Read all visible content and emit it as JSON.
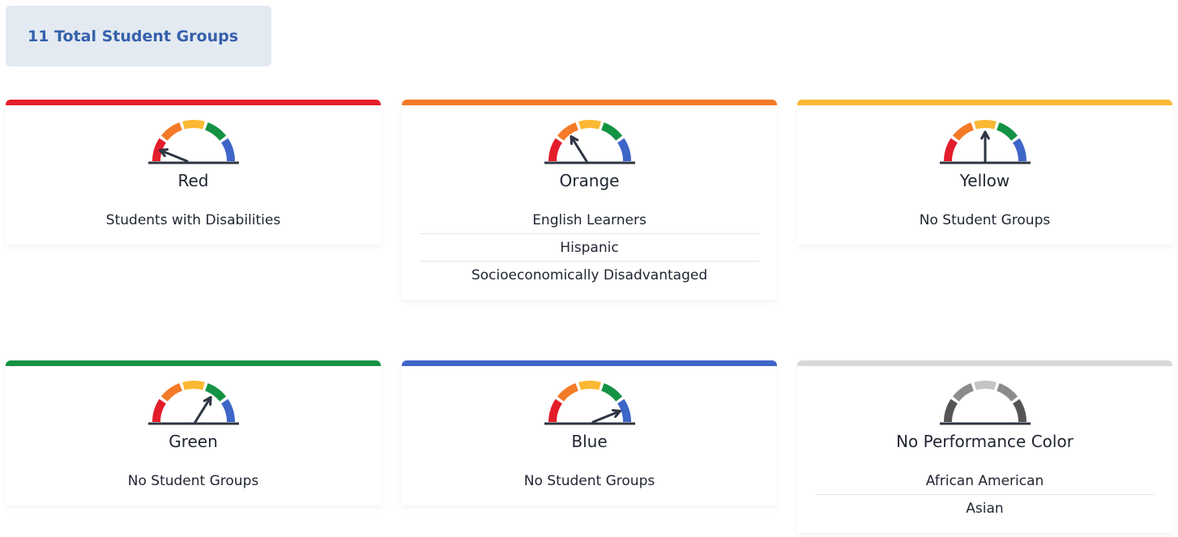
{
  "summary": {
    "total_label": "11 Total Student Groups"
  },
  "colors": {
    "red": "#e41d2b",
    "orange": "#f47a28",
    "yellow": "#fbb832",
    "green": "#139343",
    "blue": "#3e65c8",
    "none": "#d8d8d8",
    "needle": "#2d3442"
  },
  "cards": [
    {
      "label": "Red",
      "level": "red",
      "groups": [
        "Students with Disabilities"
      ]
    },
    {
      "label": "Orange",
      "level": "orange",
      "groups": [
        "English Learners",
        "Hispanic",
        "Socioeconomically Disadvantaged"
      ]
    },
    {
      "label": "Yellow",
      "level": "yellow",
      "groups": [
        "No Student Groups"
      ]
    },
    {
      "label": "Green",
      "level": "green",
      "groups": [
        "No Student Groups"
      ]
    },
    {
      "label": "Blue",
      "level": "blue",
      "groups": [
        "No Student Groups"
      ]
    },
    {
      "label": "No Performance Color",
      "level": "none",
      "groups": [
        "African American",
        "Asian"
      ]
    }
  ]
}
